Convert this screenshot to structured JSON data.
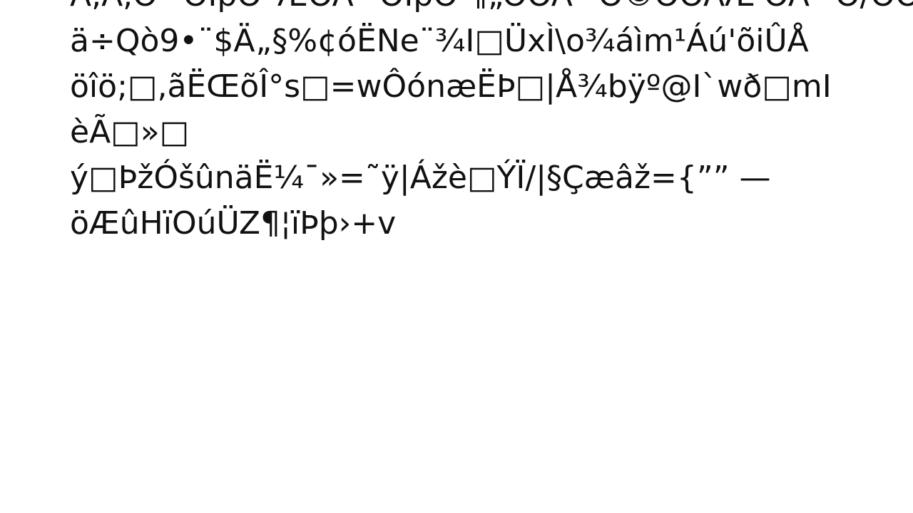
{
  "document": {
    "lines": [
      "Ä,Ä,Ö ¯ÔÌpÔ¨ÆÖÄ ¯ÔÌpÔ ¶„ÔÖÄ ¯Ô©ÔÖÄÆ'ÖÄ ¯Ô/ÔÖÄÆ,",
      "ä÷Qò9•¨$Ä„§%¢óËNe¨¾I□ÜxÌ\\o¾áìm¹Áú'õiÛÅ",
      "öîö;□,ãËŒõÎ°s□=wÔónæËÞ□|Å¾bÿº@I`wð□mI",
      "èÃ□»□",
      "ý□ÞžÓšûnäË¼¯»=˜ÿ|Ážè□ÝÏ/|§Çæâž={”” —",
      "öÆûHïOúÜZ¶¦ïÞþ›+v"
    ]
  },
  "colors": {
    "background": "#ffffff",
    "text": "#111111"
  }
}
